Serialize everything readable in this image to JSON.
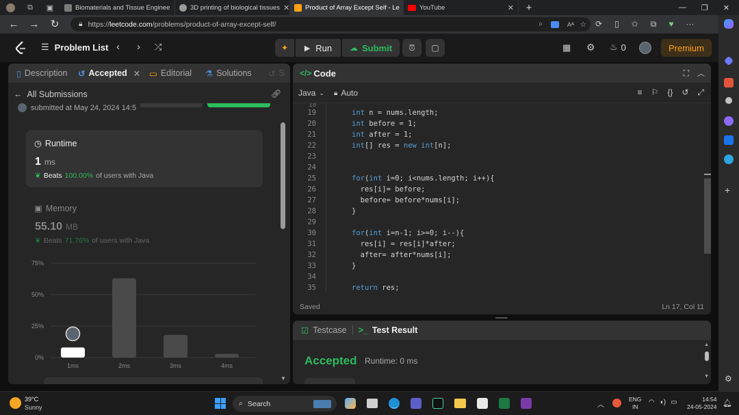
{
  "browser": {
    "tabs": [
      {
        "title": "Biomaterials and Tissue Enginee",
        "color": "#7a7a7a"
      },
      {
        "title": "3D printing of biological tissues",
        "color": "#9a9a9a"
      },
      {
        "title": "Product of Array Except Self - Le",
        "color": "#ffa116"
      },
      {
        "title": "YouTube",
        "color": "#ff0000"
      }
    ],
    "url_prefix": "https://",
    "url_host": "leetcode.com",
    "url_path": "/problems/product-of-array-except-self/"
  },
  "nav": {
    "problem_list": "Problem List",
    "run": "Run",
    "submit": "Submit",
    "streak": "0",
    "premium": "Premium"
  },
  "left_tabs": [
    "Description",
    "Accepted",
    "Editorial",
    "Solutions",
    "S"
  ],
  "submission": {
    "back": "All Submissions",
    "submitted": "submitted at May 24, 2024 14:5",
    "runtime_label": "Runtime",
    "runtime_value": "1",
    "runtime_unit": "ms",
    "runtime_beats_prefix": "Beats",
    "runtime_beats_pct": "100.00%",
    "runtime_beats_suffix": "of users with Java",
    "memory_label": "Memory",
    "memory_value": "55.10",
    "memory_unit": "MB",
    "memory_beats_prefix": "Beats",
    "memory_beats_pct": "71.76%",
    "memory_beats_suffix": "of users with Java"
  },
  "chart_data": {
    "type": "bar",
    "categories": [
      "1ms",
      "2ms",
      "3ms",
      "4ms"
    ],
    "values": [
      8,
      63,
      18,
      3
    ],
    "highlight_index": 0,
    "ylim": [
      0,
      75
    ],
    "yticks": [
      "75%",
      "50%",
      "25%",
      "0%"
    ],
    "ytick_values": [
      75,
      50,
      25,
      0
    ],
    "grid": true
  },
  "code_panel": {
    "title": "Code",
    "language": "Java",
    "mode": "Auto",
    "status": "Saved",
    "cursor": "Ln 17, Col 11",
    "lines": [
      {
        "n": "19",
        "text": "int n = nums.length;"
      },
      {
        "n": "20",
        "text": "int before = 1;"
      },
      {
        "n": "21",
        "text": "int after = 1;"
      },
      {
        "n": "22",
        "text": "int[] res = new int[n];"
      },
      {
        "n": "23",
        "text": ""
      },
      {
        "n": "24",
        "text": ""
      },
      {
        "n": "25",
        "text": "for(int i=0; i<nums.length; i++){"
      },
      {
        "n": "26",
        "text": "  res[i]= before;"
      },
      {
        "n": "27",
        "text": "  before= before*nums[i];"
      },
      {
        "n": "28",
        "text": "}"
      },
      {
        "n": "29",
        "text": ""
      },
      {
        "n": "30",
        "text": "for(int i=n-1; i>=0; i--){"
      },
      {
        "n": "31",
        "text": "  res[i] = res[i]*after;"
      },
      {
        "n": "32",
        "text": "  after= after*nums[i];"
      },
      {
        "n": "33",
        "text": "}"
      },
      {
        "n": "34",
        "text": ""
      },
      {
        "n": "35",
        "text": "return res;"
      }
    ]
  },
  "test_panel": {
    "testcase": "Testcase",
    "test_result": "Test Result",
    "accepted": "Accepted",
    "runtime": "Runtime: 0 ms"
  },
  "taskbar": {
    "temp": "39°C",
    "weather": "Sunny",
    "search": "Search",
    "lang1": "ENG",
    "lang2": "IN",
    "time": "14:54",
    "date": "24-05-2024"
  }
}
